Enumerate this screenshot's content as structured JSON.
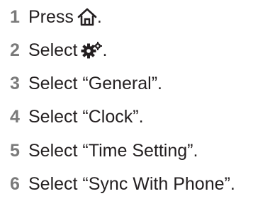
{
  "steps": [
    {
      "number": "1",
      "text": "Press",
      "icon": "home-icon",
      "suffix": "."
    },
    {
      "number": "2",
      "text": "Select",
      "icon": "settings-gears-icon",
      "suffix": "."
    },
    {
      "number": "3",
      "text": "Select “General”."
    },
    {
      "number": "4",
      "text": "Select “Clock”."
    },
    {
      "number": "5",
      "text": "Select “Time Setting”."
    },
    {
      "number": "6",
      "text": "Select “Sync With Phone”."
    }
  ],
  "colors": {
    "number": "#7a7a7a",
    "text": "#231f20"
  }
}
